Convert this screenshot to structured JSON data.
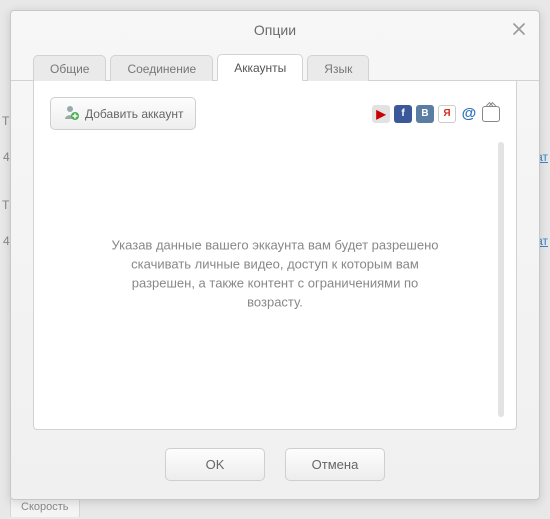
{
  "window": {
    "title": "Опции"
  },
  "tabs": {
    "general": "Общие",
    "connection": "Соединение",
    "accounts": "Аккаунты",
    "language": "Язык"
  },
  "accounts": {
    "add_button": "Добавить аккаунт",
    "services": {
      "youtube": "▶",
      "facebook": "f",
      "vk": "B",
      "yandex": "Я",
      "mail": "@",
      "tv": ""
    },
    "hint": "Указав данные вашего эккаунта вам будет разрешено скачивать личные видео, доступ к которым вам разрешен, а также контент с ограничениями по возрасту."
  },
  "footer": {
    "ok": "OK",
    "cancel": "Отмена"
  },
  "background": {
    "speed": "Скорость",
    "link": "ат",
    "cut1": "ТВ",
    "num1": "4"
  }
}
